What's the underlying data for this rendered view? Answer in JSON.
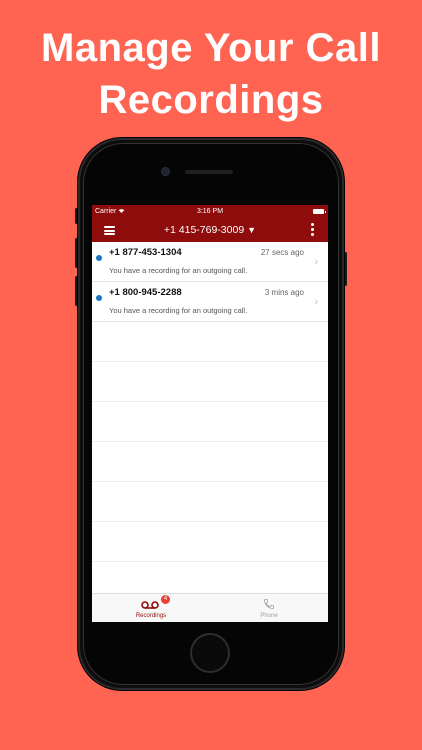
{
  "headline": {
    "line1": "Manage Your Call",
    "line2": "Recordings"
  },
  "colors": {
    "background": "#ff6452",
    "brand": "#8e0c0c",
    "unread_dot": "#1c72c2",
    "badge": "#e84133"
  },
  "status_bar": {
    "carrier": "Carrier",
    "time": "3:16 PM"
  },
  "nav_bar": {
    "title": "+1 415-769-3009",
    "title_caret": "▼",
    "left_icon": "menu-icon",
    "right_icon": "more-vertical-icon"
  },
  "recordings": [
    {
      "number": "+1 877-453-1304",
      "age": "27 secs ago",
      "description": "You have a recording for an outgoing call.",
      "unread": true
    },
    {
      "number": "+1 800-945-2288",
      "age": "3 mins ago",
      "description": "You have a recording for an outgoing call.",
      "unread": true
    }
  ],
  "tab_bar": {
    "tabs": [
      {
        "label": "Recordings",
        "icon": "voicemail-icon",
        "badge": "4",
        "selected": true
      },
      {
        "label": "Phone",
        "icon": "phone-icon",
        "selected": false
      }
    ]
  }
}
